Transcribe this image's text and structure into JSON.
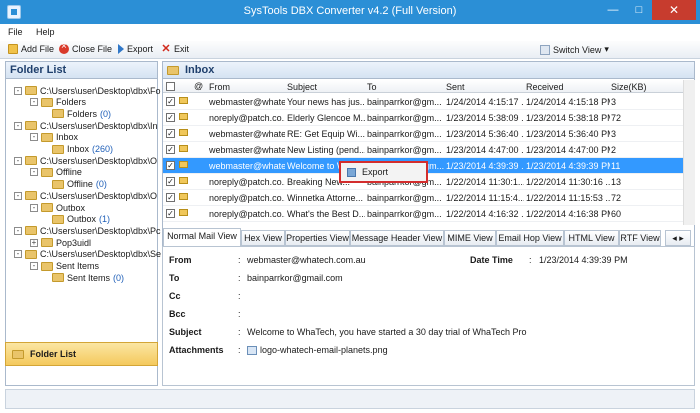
{
  "window": {
    "title": "SysTools DBX Converter v4.2 (Full Version)"
  },
  "menu": {
    "file": "File",
    "help": "Help"
  },
  "toolbar": {
    "add_file": "Add File",
    "close_file": "Close File",
    "export": "Export",
    "exit": "Exit",
    "switch_view": "Switch View"
  },
  "sidebar": {
    "title": "Folder List",
    "bottom_label": "Folder List",
    "tree": [
      {
        "label": "C:\\Users\\user\\Desktop\\dbx\\Fo",
        "level": 0,
        "expander": "-"
      },
      {
        "label": "Folders",
        "level": 1,
        "expander": "-"
      },
      {
        "label": "Folders",
        "count": "(0)",
        "level": 2
      },
      {
        "label": "C:\\Users\\user\\Desktop\\dbx\\In",
        "level": 0,
        "expander": "-"
      },
      {
        "label": "Inbox",
        "level": 1,
        "expander": "-"
      },
      {
        "label": "Inbox",
        "count": "(260)",
        "level": 2
      },
      {
        "label": "C:\\Users\\user\\Desktop\\dbx\\O",
        "level": 0,
        "expander": "-"
      },
      {
        "label": "Offline",
        "level": 1,
        "expander": "-"
      },
      {
        "label": "Offline",
        "count": "(0)",
        "level": 2
      },
      {
        "label": "C:\\Users\\user\\Desktop\\dbx\\O",
        "level": 0,
        "expander": "-"
      },
      {
        "label": "Outbox",
        "level": 1,
        "expander": "-"
      },
      {
        "label": "Outbox",
        "count": "(1)",
        "level": 2
      },
      {
        "label": "C:\\Users\\user\\Desktop\\dbx\\Pc",
        "level": 0,
        "expander": "-"
      },
      {
        "label": "Pop3uidl",
        "level": 1,
        "expander": "+"
      },
      {
        "label": "C:\\Users\\user\\Desktop\\dbx\\Se",
        "level": 0,
        "expander": "-"
      },
      {
        "label": "Sent Items",
        "level": 1,
        "expander": "-"
      },
      {
        "label": "Sent Items",
        "count": "(0)",
        "level": 2
      }
    ]
  },
  "inbox": {
    "title": "Inbox",
    "columns": {
      "from": "From",
      "subject": "Subject",
      "to": "To",
      "sent": "Sent",
      "received": "Received",
      "size": "Size(KB)"
    },
    "rows": [
      {
        "from": "webmaster@whatech...",
        "subject": "Your news has jus...",
        "to": "bainparrkor@gm...",
        "sent": "1/24/2014 4:15:17 ...",
        "received": "1/24/2014 4:15:18 PM",
        "size": "3"
      },
      {
        "from": "noreply@patch.co...",
        "subject": "Elderly Glencoe M...",
        "to": "bainparrkor@gm...",
        "sent": "1/23/2014 5:38:09 ...",
        "received": "1/23/2014 5:38:18 PM",
        "size": "72"
      },
      {
        "from": "webmaster@whatech...",
        "subject": "RE:  Get Equip Wi...",
        "to": "bainparrkor@gm...",
        "sent": "1/23/2014 5:36:40 ...",
        "received": "1/23/2014 5:36:40 PM",
        "size": "3"
      },
      {
        "from": "webmaster@whatech...",
        "subject": "New Listing (pend...",
        "to": "bainparrkor@gm...",
        "sent": "1/23/2014 4:47:00 ...",
        "received": "1/23/2014 4:47:00 PM",
        "size": "2"
      },
      {
        "from": "webmaster@whatech...",
        "subject": "Welcome to W...",
        "to": "...ainparrkor@gm...",
        "sent": "1/23/2014 4:39:39 ...",
        "received": "1/23/2014 4:39:39 PM",
        "size": "11"
      },
      {
        "from": "noreply@patch.co...",
        "subject": "Breaking New...",
        "to": "bainparrkor@gm...",
        "sent": "1/22/2014 11:30:1...",
        "received": "1/22/2014 11:30:16 ...",
        "size": "13"
      },
      {
        "from": "noreply@patch.co...",
        "subject": "Winnetka Attorne...",
        "to": "bainparrkor@gm...",
        "sent": "1/22/2014 11:15:4...",
        "received": "1/22/2014 11:15:53 ...",
        "size": "72"
      },
      {
        "from": "noreply@patch.co...",
        "subject": "What's the Best D...",
        "to": "bainparrkor@gm...",
        "sent": "1/22/2014 4:16:32 ...",
        "received": "1/22/2014 4:16:38 PM",
        "size": "60"
      }
    ]
  },
  "context_menu": {
    "export": "Export"
  },
  "tabs": [
    "Normal Mail View",
    "Hex View",
    "Properties View",
    "Message Header View",
    "MIME View",
    "Email Hop View",
    "HTML View",
    "RTF View"
  ],
  "preview": {
    "from_label": "From",
    "from_value": "webmaster@whatech.com.au",
    "date_label": "Date Time",
    "date_value": "1/23/2014 4:39:39 PM",
    "to_label": "To",
    "to_value": "bainparrkor@gmail.com",
    "cc_label": "Cc",
    "bcc_label": "Bcc",
    "subject_label": "Subject",
    "subject_value": "Welcome to WhaTech, you have started a 30 day trial of WhaTech Pro",
    "attachments_label": "Attachments",
    "attachment_file": "logo-whatech-email-planets.png"
  }
}
